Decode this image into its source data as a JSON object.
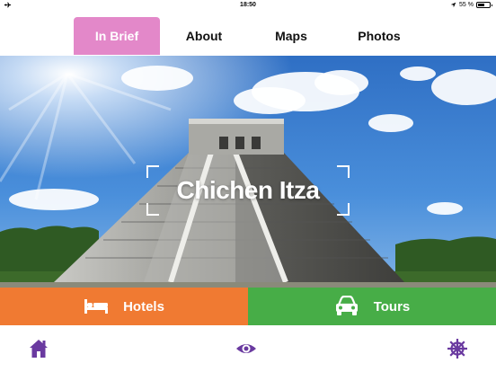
{
  "status_bar": {
    "time": "18:50",
    "battery_text": "55 %",
    "battery_fraction": 0.55
  },
  "tabs": [
    {
      "label": "In Brief",
      "active": true
    },
    {
      "label": "About",
      "active": false
    },
    {
      "label": "Maps",
      "active": false
    },
    {
      "label": "Photos",
      "active": false
    }
  ],
  "hero": {
    "title": "Chichen Itza"
  },
  "actions": {
    "hotels": {
      "label": "Hotels",
      "icon": "bed-icon",
      "color": "#f07a32"
    },
    "tours": {
      "label": "Tours",
      "icon": "car-icon",
      "color": "#47ad47"
    }
  },
  "bottom_nav": [
    {
      "icon": "home-icon"
    },
    {
      "icon": "eye-icon"
    },
    {
      "icon": "ship-wheel-icon"
    }
  ],
  "colors": {
    "accent": "#e388c9",
    "icon_purple": "#6a3aa0",
    "sky": "#2d72c8"
  }
}
